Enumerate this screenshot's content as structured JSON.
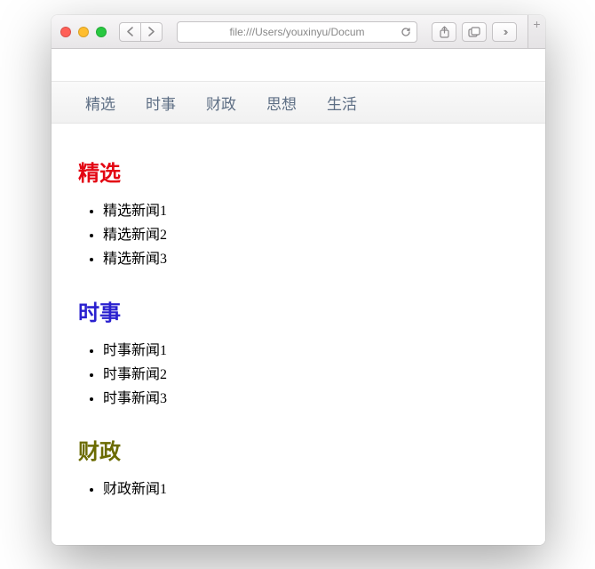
{
  "browser": {
    "url": "file:///Users/youxinyu/Docum"
  },
  "nav": {
    "items": [
      "精选",
      "时事",
      "财政",
      "思想",
      "生活"
    ]
  },
  "sections": [
    {
      "title": "精选",
      "items": [
        "精选新闻1",
        "精选新闻2",
        "精选新闻3"
      ]
    },
    {
      "title": "时事",
      "items": [
        "时事新闻1",
        "时事新闻2",
        "时事新闻3"
      ]
    },
    {
      "title": "财政",
      "items": [
        "财政新闻1"
      ]
    }
  ]
}
